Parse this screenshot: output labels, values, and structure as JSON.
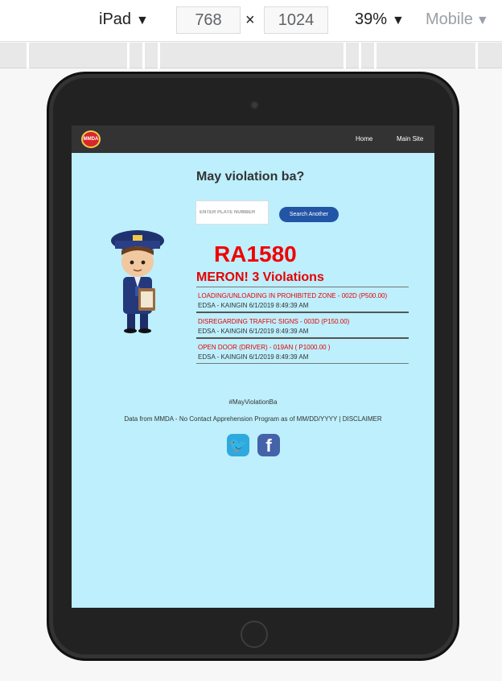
{
  "devtools": {
    "device": "iPad",
    "width": "768",
    "times": "×",
    "height": "1024",
    "zoom": "39%",
    "mode": "Mobile",
    "caret": "▼"
  },
  "nav": {
    "logo_text": "MMDA",
    "home": "Home",
    "main_site": "Main Site"
  },
  "page": {
    "title": "May violation ba?",
    "plate_placeholder": "ENTER PLATE NUMBER",
    "search_button": "Search Another",
    "plate_number": "RA1580",
    "summary": "MERON! 3 Violations"
  },
  "violations": [
    {
      "title": "LOADING/UNLOADING IN PROHIBITED ZONE - 002D (P500.00)",
      "detail": "EDSA - KAINGIN 6/1/2019 8:49:39 AM"
    },
    {
      "title": "DISREGARDING TRAFFIC SIGNS - 003D (P150.00)",
      "detail": "EDSA - KAINGIN 6/1/2019 8:49:39 AM"
    },
    {
      "title": "OPEN DOOR (DRIVER) - 019AN ( P1000.00 )",
      "detail": "EDSA - KAINGIN 6/1/2019 8:49:39 AM"
    }
  ],
  "footer": {
    "hashtag": "#MayViolationBa",
    "source": "Data from MMDA - No Contact Apprehension Program as of MM/DD/YYYY | DISCLAIMER",
    "facebook_glyph": "f",
    "twitter_glyph": "🐦"
  },
  "icons": {
    "twitter": "twitter-icon",
    "facebook": "facebook-icon",
    "logo": "mmda-logo"
  }
}
